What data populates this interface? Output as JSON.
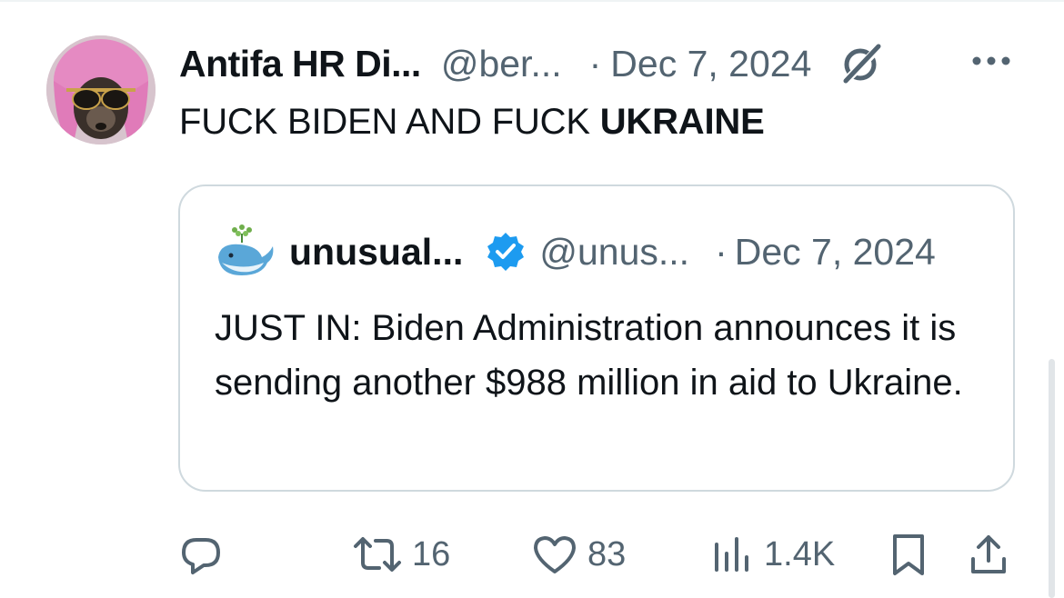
{
  "tweet": {
    "author_name": "Antifa HR Di...",
    "author_handle": "@ber...",
    "separator": "·",
    "date": "Dec 7, 2024",
    "text_plain": "FUCK BIDEN AND FUCK ",
    "text_bold": "UKRAINE"
  },
  "quote": {
    "author_name": "unusual...",
    "author_handle": "@unus...",
    "separator": "·",
    "date": "Dec 7, 2024",
    "text": "JUST IN: Biden Administration announces it is sending another $988 million in aid to Ukraine."
  },
  "actions": {
    "reply_count": "",
    "retweet_count": "16",
    "like_count": "83",
    "views_count": "1.4K"
  },
  "icons": {
    "reply": "reply-icon",
    "retweet": "retweet-icon",
    "like": "heart-icon",
    "views": "views-icon",
    "bookmark": "bookmark-icon",
    "share": "share-icon",
    "more": "more-icon",
    "grok": "grok-icon",
    "verified": "verified-badge-icon"
  },
  "colors": {
    "text": "#0f1419",
    "secondary": "#536471",
    "border": "#cfd9de",
    "verified": "#1d9bf0"
  }
}
